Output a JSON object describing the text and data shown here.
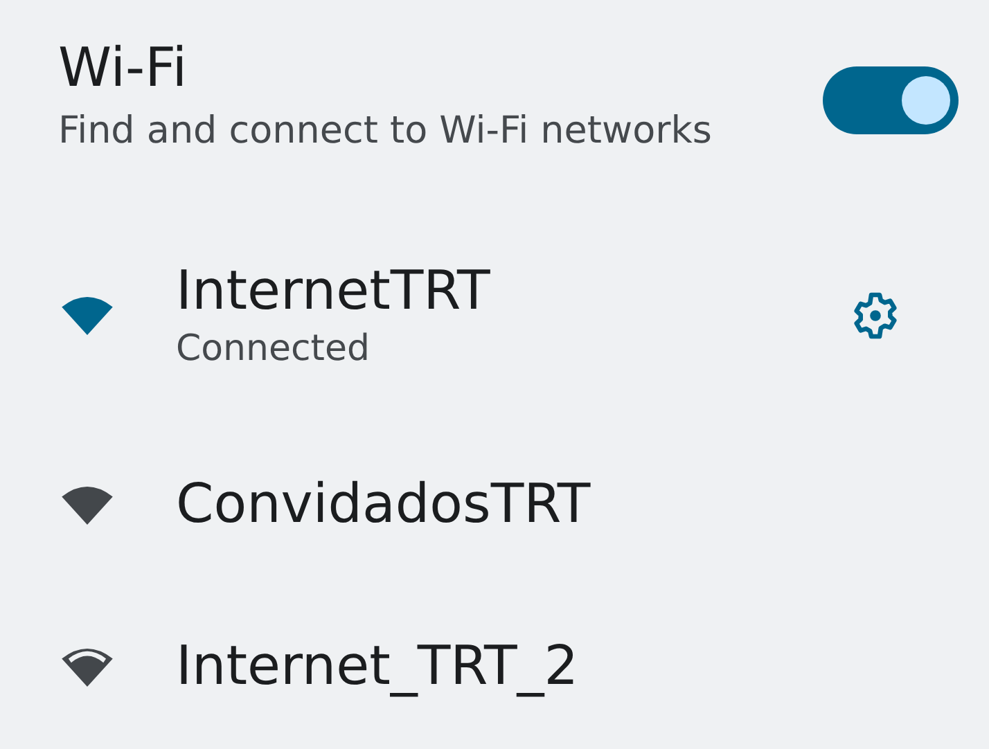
{
  "header": {
    "title": "Wi-Fi",
    "subtitle": "Find and connect to Wi-Fi networks",
    "on": true
  },
  "networks": [
    {
      "name": "InternetTRT",
      "status": "Connected",
      "connected": true,
      "kind": "full",
      "settings": true
    },
    {
      "name": "ConvidadosTRT",
      "connected": false,
      "kind": "full"
    },
    {
      "name": "Internet_TRT_2",
      "connected": false,
      "kind": "weak"
    }
  ]
}
